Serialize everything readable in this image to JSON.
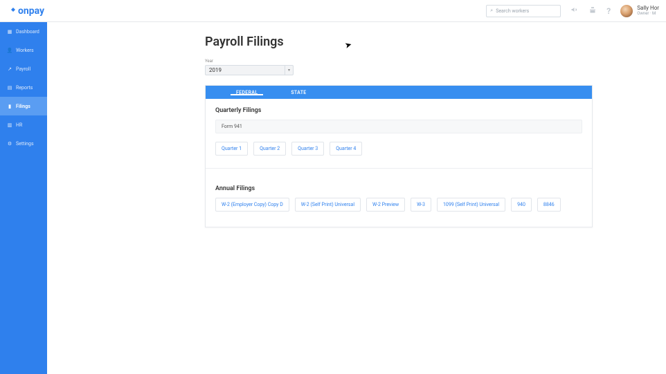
{
  "header": {
    "logo_text": "onpay",
    "search_placeholder": "Search workers",
    "user_name": "Sally Hor",
    "user_role": "Owner · M"
  },
  "sidebar": {
    "items": [
      {
        "label": "Dashboard",
        "icon": "▦"
      },
      {
        "label": "Workers",
        "icon": "👤"
      },
      {
        "label": "Payroll",
        "icon": "↗"
      },
      {
        "label": "Reports",
        "icon": "▤"
      },
      {
        "label": "Filings",
        "icon": "▮"
      },
      {
        "label": "HR",
        "icon": "▥"
      },
      {
        "label": "Settings",
        "icon": "⚙"
      }
    ],
    "active": "Filings"
  },
  "page": {
    "title": "Payroll Filings",
    "year_label": "Year",
    "year_value": "2019",
    "tabs": [
      {
        "label": "FEDERAL"
      },
      {
        "label": "STATE"
      }
    ],
    "active_tab": "FEDERAL",
    "quarterly": {
      "heading": "Quarterly Filings",
      "form_name": "Form 941",
      "quarters": [
        "Quarter 1",
        "Quarter 2",
        "Quarter 3",
        "Quarter 4"
      ]
    },
    "annual": {
      "heading": "Annual Filings",
      "forms": [
        "W-2 (Employer Copy) Copy D",
        "W-2 (Self Print) Universal",
        "W-2 Preview",
        "W-3",
        "1099 (Self Print) Universal",
        "940",
        "8846"
      ]
    }
  }
}
